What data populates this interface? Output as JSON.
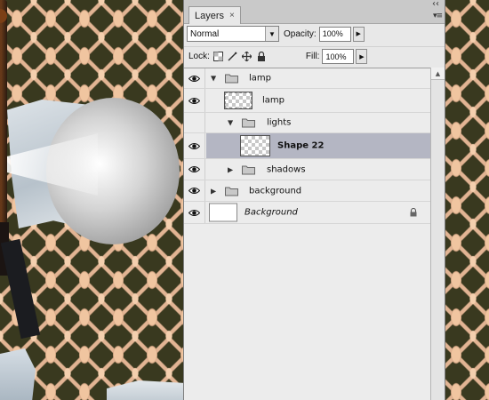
{
  "panel": {
    "tab_label": "Layers",
    "tab_close": "×",
    "minimize": "‹‹",
    "menu": "▾≡"
  },
  "options": {
    "blend_mode": "Normal",
    "opacity_label": "Opacity:",
    "opacity_value": "100%",
    "lock_label": "Lock:",
    "fill_label": "Fill:",
    "fill_value": "100%"
  },
  "icons": {
    "visibility": "eye-icon",
    "folder": "folder-icon",
    "lock": "lock-icon",
    "lock_transparent": "lock-transparent-pixels-icon",
    "lock_image": "lock-image-pixels-icon",
    "lock_position": "lock-position-icon",
    "lock_all": "lock-all-icon"
  },
  "colors": {
    "selected_row": "#b4b6c3",
    "panel_bg": "#e8e8e8",
    "pattern_dark": "#39391f",
    "pattern_light": "#f0c5a0"
  },
  "layers": [
    {
      "name": "lamp",
      "type": "group",
      "expanded": true,
      "visible": true
    },
    {
      "name": "lamp",
      "type": "layer",
      "visible": true
    },
    {
      "name": "lights",
      "type": "group",
      "expanded": true,
      "visible": false
    },
    {
      "name": "Shape 22",
      "type": "layer",
      "visible": true,
      "selected": true
    },
    {
      "name": "shadows",
      "type": "group",
      "expanded": false,
      "visible": true
    },
    {
      "name": "background",
      "type": "group",
      "expanded": false,
      "visible": true
    },
    {
      "name": "Background",
      "type": "layer",
      "visible": true,
      "locked": true
    }
  ]
}
